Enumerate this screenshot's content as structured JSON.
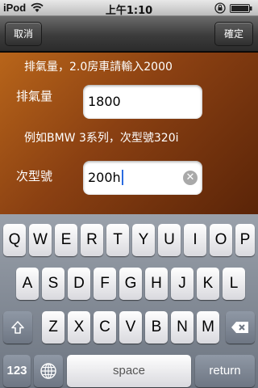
{
  "status": {
    "carrier": "iPod",
    "time": "上午1:10"
  },
  "nav": {
    "cancel_label": "取消",
    "done_label": "確定"
  },
  "form": {
    "hint_top": "排氣量，2.0房車請輸入2000",
    "displacement_label": "排氣量",
    "displacement_value": "1800",
    "hint_mid": "例如BMW 3系列，次型號320i",
    "model_label": "次型號",
    "model_value": "200h"
  },
  "keyboard": {
    "row1": [
      "Q",
      "W",
      "E",
      "R",
      "T",
      "Y",
      "U",
      "I",
      "O",
      "P"
    ],
    "row2": [
      "A",
      "S",
      "D",
      "F",
      "G",
      "H",
      "J",
      "K",
      "L"
    ],
    "row3": [
      "Z",
      "X",
      "C",
      "V",
      "B",
      "N",
      "M"
    ],
    "numbers_label": "123",
    "space_label": "space",
    "return_label": "return"
  },
  "icons": {
    "wifi": "wifi-icon",
    "lock": "rotation-lock-icon",
    "battery": "battery-icon",
    "clear": "clear-icon",
    "shift": "shift-icon",
    "delete": "delete-icon",
    "globe": "globe-icon"
  },
  "colors": {
    "nav_bar": "#3c3c3c",
    "content_bg": "#8a4012",
    "keyboard_bg": "#7f8792",
    "caret": "#2a6be0"
  }
}
